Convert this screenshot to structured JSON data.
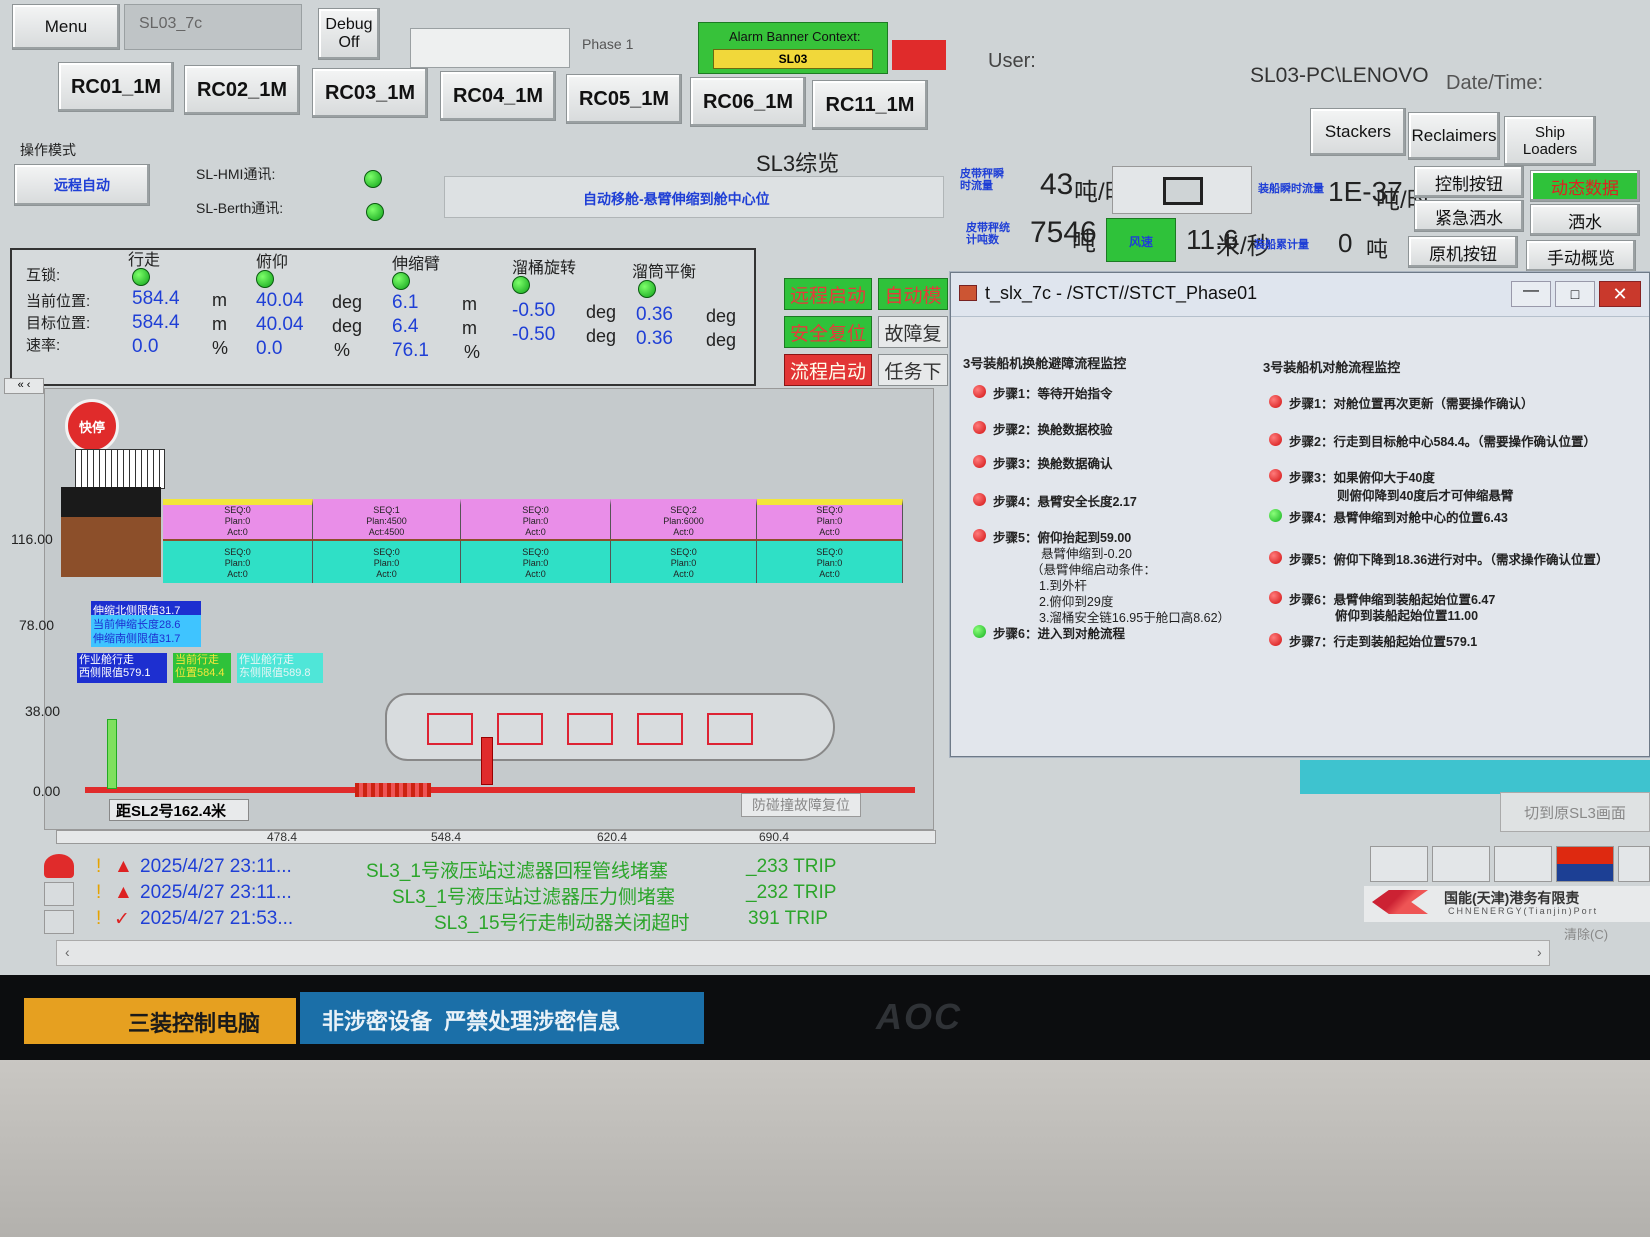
{
  "topbar": {
    "menu": "Menu",
    "station": "SL03_7c",
    "debug_line1": "Debug",
    "debug_line2": "Off",
    "phase": "Phase 1",
    "alarm_banner_title": "Alarm Banner Context:",
    "alarm_banner_value": "SL03",
    "user_label": "User:",
    "user_value": "SL03-PC\\LENOVO",
    "datetime_label": "Date/Time:"
  },
  "rc_tabs": [
    "RC01_1M",
    "RC02_1M",
    "RC03_1M",
    "RC04_1M",
    "RC05_1M",
    "RC06_1M",
    "RC11_1M"
  ],
  "right_tabs": {
    "stackers": "Stackers",
    "reclaimers": "Reclaimers",
    "ship_line1": "Ship",
    "ship_line2": "Loaders"
  },
  "header": {
    "mode_label": "操作模式",
    "mode_button": "远程自动",
    "hmi_comm": "SL-HMI通讯:",
    "berth_comm": "SL-Berth通讯:",
    "page_title": "SL3综览",
    "status_message": "自动移舱-悬臂伸缩到舱中心位"
  },
  "metrics": {
    "belt_flow_label": "皮带秤瞬时流量",
    "belt_flow_value": "43",
    "belt_flow_unit": "吨/时",
    "belt_total_label": "皮带秤统计吨数",
    "belt_total_value": "7546",
    "belt_total_unit": "吨",
    "wind_label": "风速",
    "wind_value": "11.6",
    "wind_unit": "米/秒",
    "ship_flow_label": "装船瞬时流量",
    "ship_flow_value": "1E-37",
    "ship_flow_unit": "吨/时",
    "ship_total_label": "装船累计量",
    "ship_total_value": "0",
    "ship_total_unit": "吨"
  },
  "right_buttons": [
    "控制按钮",
    "动态数据",
    "紧急洒水",
    "洒水",
    "原机按钮",
    "手动概览"
  ],
  "motion_table": {
    "row_labels": [
      "互锁:",
      "当前位置:",
      "目标位置:",
      "速率:"
    ],
    "columns": [
      {
        "name": "行走",
        "current": "584.4",
        "target": "584.4",
        "rate": "0.0",
        "unit": "m",
        "rate_unit": "%"
      },
      {
        "name": "俯仰",
        "current": "40.04",
        "target": "40.04",
        "rate": "0.0",
        "unit": "deg",
        "rate_unit": "%"
      },
      {
        "name": "伸缩臂",
        "current": "6.1",
        "target": "6.4",
        "rate": "76.1",
        "unit": "m",
        "rate_unit": "%"
      },
      {
        "name": "溜桶旋转",
        "current": "-0.50",
        "target": "-0.50",
        "rate": "",
        "unit": "deg",
        "rate_unit": ""
      },
      {
        "name": "溜筒平衡",
        "current": "0.36",
        "target": "0.36",
        "rate": "",
        "unit": "deg",
        "rate_unit": ""
      }
    ]
  },
  "command_buttons": {
    "remote_start": "远程启动",
    "auto_mode": "自动模",
    "safe_reset": "安全复位",
    "fault_reset": "故障复",
    "flow_start": "流程启动",
    "task": "任务下"
  },
  "ship_view": {
    "estop": "快停",
    "y_axis": [
      "116.00",
      "78.00",
      "38.00",
      "0.00"
    ],
    "x_axis": [
      "478.4",
      "548.4",
      "620.4",
      "690.4"
    ],
    "holds_top": [
      {
        "seq": "SEQ:0",
        "plan": "Plan:0",
        "act": "Act:0",
        "color": "#e98ee8"
      },
      {
        "seq": "SEQ:1",
        "plan": "Plan:4500",
        "act": "Act:4500",
        "color": "#e98ee8"
      },
      {
        "seq": "SEQ:0",
        "plan": "Plan:0",
        "act": "Act:0",
        "color": "#e98ee8"
      },
      {
        "seq": "SEQ:2",
        "plan": "Plan:6000",
        "act": "Act:0",
        "color": "#e98ee8"
      },
      {
        "seq": "SEQ:0",
        "plan": "Plan:0",
        "act": "Act:0",
        "color": "#e98ee8"
      }
    ],
    "holds_bottom": [
      {
        "seq": "SEQ:0",
        "plan": "Plan:0",
        "act": "Act:0"
      },
      {
        "seq": "SEQ:0",
        "plan": "Plan:0",
        "act": "Act:0"
      },
      {
        "seq": "SEQ:0",
        "plan": "Plan:0",
        "act": "Act:0"
      },
      {
        "seq": "SEQ:0",
        "plan": "Plan:0",
        "act": "Act:0"
      },
      {
        "seq": "SEQ:0",
        "plan": "Plan:0",
        "act": "Act:0"
      }
    ],
    "limit_north": "伸缩北侧限值31.7",
    "current_extend": "当前伸缩长度28.6",
    "limit_south": "伸缩南侧限值31.7",
    "west_limit_line1": "作业舱行走",
    "west_limit_line2": "西侧限值579.1",
    "current_travel_line1": "当前行走",
    "current_travel_line2": "位置584.4",
    "east_limit_line1": "作业舱行走",
    "east_limit_line2": "东侧限值589.8",
    "distance_sl2": "距SL2号162.4米",
    "anti_collision": "防碰撞故障复位"
  },
  "dialog": {
    "title": "t_slx_7c - /STCT//STCT_Phase01",
    "left_title": "3号装船机换舱避障流程监控",
    "right_title": "3号装船机对舱流程监控",
    "left_steps": [
      {
        "text": "步骤1：等待开始指令",
        "status": "red"
      },
      {
        "text": "步骤2：换舱数据校验",
        "status": "red"
      },
      {
        "text": "步骤3：换舱数据确认",
        "status": "red"
      },
      {
        "text": "步骤4：悬臂安全长度2.17",
        "status": "red"
      },
      {
        "text": "步骤5：俯仰抬起到59.00",
        "status": "red"
      },
      {
        "text": "步骤6：进入到对舱流程",
        "status": "green"
      }
    ],
    "left_step5_details": [
      "悬臂伸缩到-0.20",
      "（悬臂伸缩启动条件：",
      "1.到外杆",
      "2.俯仰到29度",
      "3.溜桶安全链16.95于舱口高8.62）"
    ],
    "right_steps": [
      {
        "text": "步骤1：对舱位置再次更新（需要操作确认）",
        "status": "red"
      },
      {
        "text": "步骤2：行走到目标舱中心584.4。（需要操作确认位置）",
        "status": "red"
      },
      {
        "text": "步骤3：如果俯仰大于40度",
        "status": "red"
      },
      {
        "text": "步骤4：悬臂伸缩到对舱中心的位置6.43",
        "status": "green"
      },
      {
        "text": "步骤5：俯仰下降到18.36进行对中。（需求操作确认位置）",
        "status": "red"
      },
      {
        "text": "步骤6：悬臂伸缩到装船起始位置6.47",
        "status": "red"
      },
      {
        "text": "步骤7：行走到装船起始位置579.1",
        "status": "red"
      }
    ],
    "right_step3_detail": "则俯仰降到40度后才可伸缩悬臂",
    "right_step6_detail": "俯仰到装船起始位置11.00"
  },
  "switch_button": "切到原SL3画面",
  "alarms": [
    {
      "time": "2025/4/27 23:11...",
      "message": "SL3_1号液压站过滤器回程管线堵塞",
      "code": "_233 TRIP"
    },
    {
      "time": "2025/4/27 23:11...",
      "message": "SL3_1号液压站过滤器压力侧堵塞",
      "code": "_232 TRIP"
    },
    {
      "time": "2025/4/27 21:53...",
      "message": "SL3_15号行走制动器关闭超时",
      "code": "391 TRIP"
    }
  ],
  "company": {
    "name": "国能(天津)港务有限责",
    "english": "CHNENERGY(Tianjin)Port"
  },
  "status_corner": "清除(C)",
  "monitor": {
    "sticker_yellow": "三装控制电脑",
    "sticker_blue": "非涉密设备  严禁处理涉密信息",
    "brand": "AOC"
  },
  "colors": {
    "accent_green": "#2fc23a",
    "alarm_red": "#e23535",
    "value_blue": "#1f3fd6",
    "alarm_text": "#2ba52a"
  }
}
